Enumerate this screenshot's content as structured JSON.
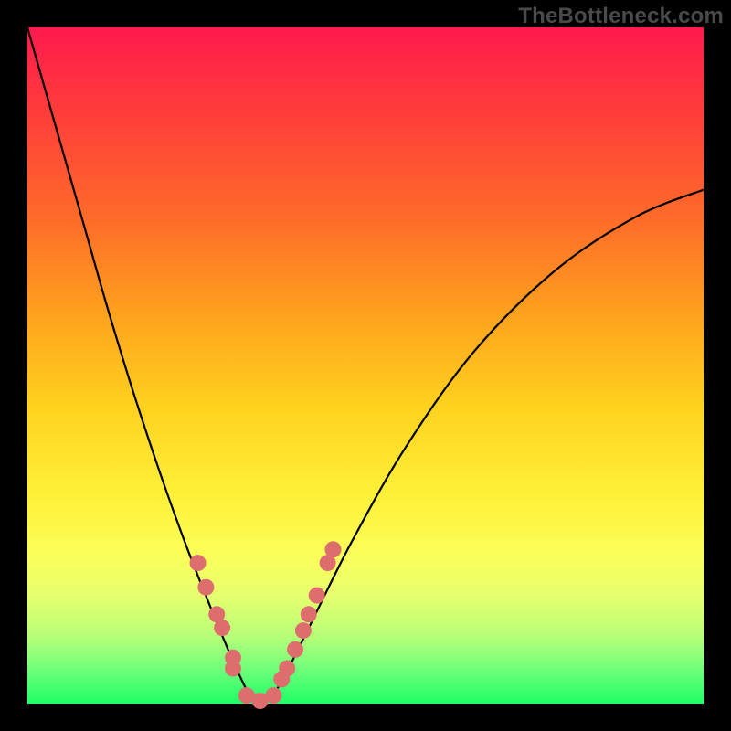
{
  "watermark": "TheBottleneck.com",
  "chart_data": {
    "type": "line",
    "title": "",
    "xlabel": "",
    "ylabel": "",
    "xlim": [
      0,
      100
    ],
    "ylim": [
      0,
      100
    ],
    "series": [
      {
        "name": "bottleneck-curve",
        "x": [
          0,
          4,
          8,
          12,
          16,
          20,
          24,
          28,
          31,
          33,
          34.5,
          36,
          38,
          42,
          48,
          56,
          66,
          78,
          90,
          100
        ],
        "y": [
          100,
          86,
          72,
          58,
          45,
          33,
          22,
          12,
          5,
          1,
          0,
          1,
          4,
          12,
          24,
          38,
          52,
          64,
          72,
          76
        ]
      }
    ],
    "markers": {
      "name": "curve-dots",
      "color": "#de6e6e",
      "radius_px": 9,
      "x": [
        25.2,
        26.4,
        28.0,
        28.8,
        30.4,
        30.4,
        32.4,
        34.4,
        36.4,
        37.6,
        38.4,
        39.6,
        40.8,
        41.6,
        42.8,
        44.4,
        45.2
      ],
      "y": [
        20.8,
        17.2,
        13.2,
        11.2,
        6.8,
        5.2,
        1.2,
        0.4,
        1.2,
        3.6,
        5.2,
        8.0,
        10.8,
        13.2,
        16.0,
        20.8,
        22.8
      ]
    }
  }
}
